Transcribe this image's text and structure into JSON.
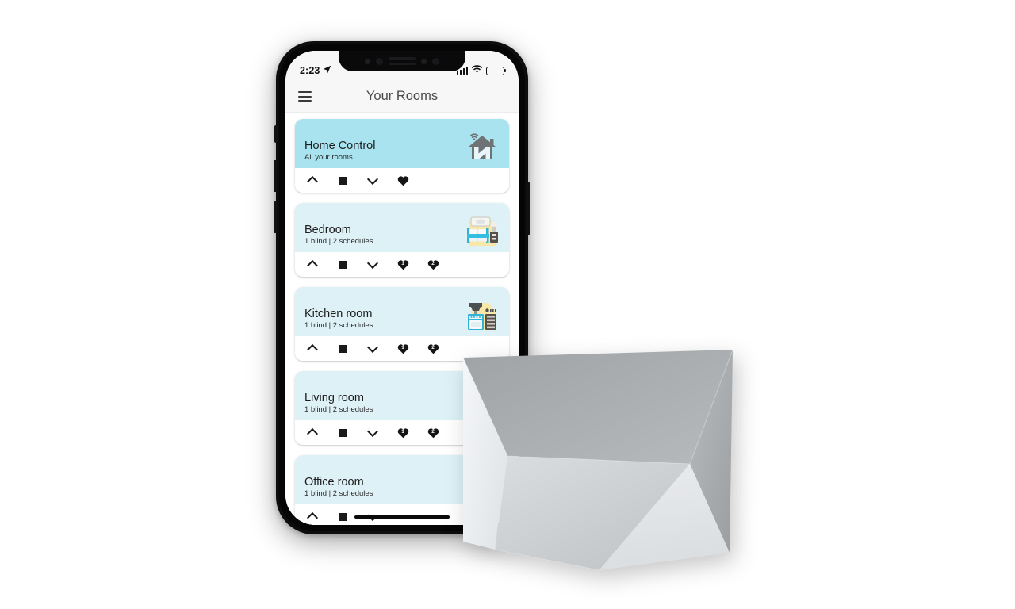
{
  "device": {
    "type": "smartphone-mockup",
    "status_bar": {
      "time": "2:23",
      "location_icon": "location-arrow-icon",
      "cellular_icon": "cellular-signal-icon",
      "wifi_icon": "wifi-icon",
      "battery_icon": "battery-icon"
    }
  },
  "app": {
    "header": {
      "menu_icon": "hamburger-menu-icon",
      "title": "Your Rooms"
    },
    "rooms": [
      {
        "name": "Home Control",
        "subtitle": "All your rooms",
        "art_icon": "house-wifi-n-logo-icon",
        "header_color": "#a8e3ef",
        "controls": [
          {
            "icon": "chevron-up-icon",
            "label": "Open"
          },
          {
            "icon": "stop-square-icon",
            "label": "Stop"
          },
          {
            "icon": "chevron-down-icon",
            "label": "Close"
          },
          {
            "icon": "heart-icon",
            "label": "Favorite",
            "badge": ""
          }
        ]
      },
      {
        "name": "Bedroom",
        "subtitle": "1 blind | 2 schedules",
        "art_icon": "bed-icon",
        "header_color": "#ddf1f7",
        "controls": [
          {
            "icon": "chevron-up-icon",
            "label": "Open"
          },
          {
            "icon": "stop-square-icon",
            "label": "Stop"
          },
          {
            "icon": "chevron-down-icon",
            "label": "Close"
          },
          {
            "icon": "heart-icon",
            "label": "Favorite 1",
            "badge": "1"
          },
          {
            "icon": "heart-icon",
            "label": "Favorite 2",
            "badge": "2"
          }
        ]
      },
      {
        "name": "Kitchen room",
        "subtitle": "1 blind | 2 schedules",
        "art_icon": "kitchen-stove-icon",
        "header_color": "#ddf1f7",
        "controls": [
          {
            "icon": "chevron-up-icon",
            "label": "Open"
          },
          {
            "icon": "stop-square-icon",
            "label": "Stop"
          },
          {
            "icon": "chevron-down-icon",
            "label": "Close"
          },
          {
            "icon": "heart-icon",
            "label": "Favorite 1",
            "badge": "1"
          },
          {
            "icon": "heart-icon",
            "label": "Favorite 2",
            "badge": "2"
          }
        ]
      },
      {
        "name": "Living room",
        "subtitle": "1 blind | 2 schedules",
        "art_icon": "couch-icon",
        "header_color": "#ddf1f7",
        "controls": [
          {
            "icon": "chevron-up-icon",
            "label": "Open"
          },
          {
            "icon": "stop-square-icon",
            "label": "Stop"
          },
          {
            "icon": "chevron-down-icon",
            "label": "Close"
          },
          {
            "icon": "heart-icon",
            "label": "Favorite 1",
            "badge": "1"
          },
          {
            "icon": "heart-icon",
            "label": "Favorite 2",
            "badge": "2"
          }
        ]
      },
      {
        "name": "Office room",
        "subtitle": "1 blind | 2 schedules",
        "art_icon": "desk-chair-icon",
        "header_color": "#ddf1f7",
        "controls": []
      }
    ]
  },
  "product": {
    "name": "faceted-panel-object",
    "colors": {
      "facet_light": "#f2f4f6",
      "facet_mid": "#d3d6d8",
      "facet_dark": "#a9acae",
      "facet_center": "#c9cccd"
    }
  }
}
